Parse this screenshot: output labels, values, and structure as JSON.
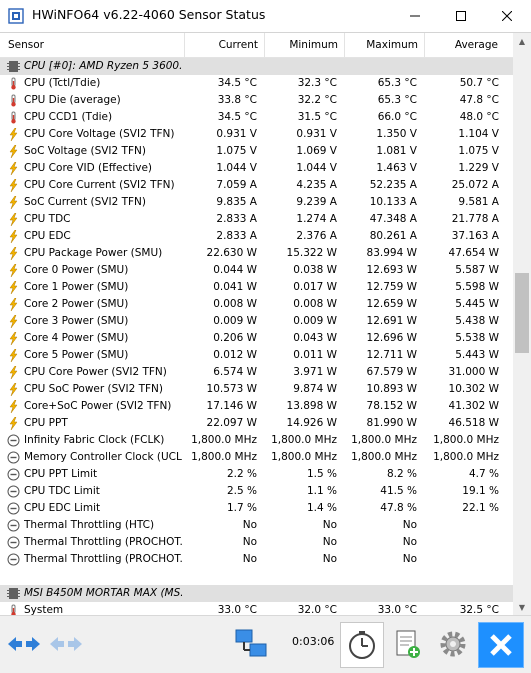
{
  "window": {
    "title": "HWiNFO64 v6.22-4060 Sensor Status"
  },
  "columns": {
    "sensor": "Sensor",
    "current": "Current",
    "minimum": "Minimum",
    "maximum": "Maximum",
    "average": "Average"
  },
  "rows": [
    {
      "type": "group",
      "name": "CPU [#0]: AMD Ryzen 5 3600...",
      "icon": "chip-icon"
    },
    {
      "type": "sensor",
      "icon": "thermometer-icon",
      "name": "CPU (Tctl/Tdie)",
      "current": "34.5 °C",
      "min": "32.3 °C",
      "max": "65.3 °C",
      "avg": "50.7 °C"
    },
    {
      "type": "sensor",
      "icon": "thermometer-icon",
      "name": "CPU Die (average)",
      "current": "33.8 °C",
      "min": "32.2 °C",
      "max": "65.3 °C",
      "avg": "47.8 °C"
    },
    {
      "type": "sensor",
      "icon": "thermometer-icon",
      "name": "CPU CCD1 (Tdie)",
      "current": "34.5 °C",
      "min": "31.5 °C",
      "max": "66.0 °C",
      "avg": "48.0 °C"
    },
    {
      "type": "sensor",
      "icon": "lightning-icon",
      "name": "CPU Core Voltage (SVI2 TFN)",
      "current": "0.931 V",
      "min": "0.931 V",
      "max": "1.350 V",
      "avg": "1.104 V"
    },
    {
      "type": "sensor",
      "icon": "lightning-icon",
      "name": "SoC Voltage (SVI2 TFN)",
      "current": "1.075 V",
      "min": "1.069 V",
      "max": "1.081 V",
      "avg": "1.075 V"
    },
    {
      "type": "sensor",
      "icon": "lightning-icon",
      "name": "CPU Core VID (Effective)",
      "current": "1.044 V",
      "min": "1.044 V",
      "max": "1.463 V",
      "avg": "1.229 V"
    },
    {
      "type": "sensor",
      "icon": "lightning-icon",
      "name": "CPU Core Current (SVI2 TFN)",
      "current": "7.059 A",
      "min": "4.235 A",
      "max": "52.235 A",
      "avg": "25.072 A"
    },
    {
      "type": "sensor",
      "icon": "lightning-icon",
      "name": "SoC Current (SVI2 TFN)",
      "current": "9.835 A",
      "min": "9.239 A",
      "max": "10.133 A",
      "avg": "9.581 A"
    },
    {
      "type": "sensor",
      "icon": "lightning-icon",
      "name": "CPU TDC",
      "current": "2.833 A",
      "min": "1.274 A",
      "max": "47.348 A",
      "avg": "21.778 A"
    },
    {
      "type": "sensor",
      "icon": "lightning-icon",
      "name": "CPU EDC",
      "current": "2.833 A",
      "min": "2.376 A",
      "max": "80.261 A",
      "avg": "37.163 A"
    },
    {
      "type": "sensor",
      "icon": "lightning-icon",
      "name": "CPU Package Power (SMU)",
      "current": "22.630 W",
      "min": "15.322 W",
      "max": "83.994 W",
      "avg": "47.654 W"
    },
    {
      "type": "sensor",
      "icon": "lightning-icon",
      "name": "Core 0 Power (SMU)",
      "current": "0.044 W",
      "min": "0.038 W",
      "max": "12.693 W",
      "avg": "5.587 W"
    },
    {
      "type": "sensor",
      "icon": "lightning-icon",
      "name": "Core 1 Power (SMU)",
      "current": "0.041 W",
      "min": "0.017 W",
      "max": "12.759 W",
      "avg": "5.598 W"
    },
    {
      "type": "sensor",
      "icon": "lightning-icon",
      "name": "Core 2 Power (SMU)",
      "current": "0.008 W",
      "min": "0.008 W",
      "max": "12.659 W",
      "avg": "5.445 W"
    },
    {
      "type": "sensor",
      "icon": "lightning-icon",
      "name": "Core 3 Power (SMU)",
      "current": "0.009 W",
      "min": "0.009 W",
      "max": "12.691 W",
      "avg": "5.438 W"
    },
    {
      "type": "sensor",
      "icon": "lightning-icon",
      "name": "Core 4 Power (SMU)",
      "current": "0.206 W",
      "min": "0.043 W",
      "max": "12.696 W",
      "avg": "5.538 W"
    },
    {
      "type": "sensor",
      "icon": "lightning-icon",
      "name": "Core 5 Power (SMU)",
      "current": "0.012 W",
      "min": "0.011 W",
      "max": "12.711 W",
      "avg": "5.443 W"
    },
    {
      "type": "sensor",
      "icon": "lightning-icon",
      "name": "CPU Core Power (SVI2 TFN)",
      "current": "6.574 W",
      "min": "3.971 W",
      "max": "67.579 W",
      "avg": "31.000 W"
    },
    {
      "type": "sensor",
      "icon": "lightning-icon",
      "name": "CPU SoC Power (SVI2 TFN)",
      "current": "10.573 W",
      "min": "9.874 W",
      "max": "10.893 W",
      "avg": "10.302 W"
    },
    {
      "type": "sensor",
      "icon": "lightning-icon",
      "name": "Core+SoC Power (SVI2 TFN)",
      "current": "17.146 W",
      "min": "13.898 W",
      "max": "78.152 W",
      "avg": "41.302 W"
    },
    {
      "type": "sensor",
      "icon": "lightning-icon",
      "name": "CPU PPT",
      "current": "22.097 W",
      "min": "14.926 W",
      "max": "81.990 W",
      "avg": "46.518 W"
    },
    {
      "type": "sensor",
      "icon": "clock-icon",
      "name": "Infinity Fabric Clock (FCLK)",
      "current": "1,800.0 MHz",
      "min": "1,800.0 MHz",
      "max": "1,800.0 MHz",
      "avg": "1,800.0 MHz"
    },
    {
      "type": "sensor",
      "icon": "clock-icon",
      "name": "Memory Controller Clock (UCLK)",
      "current": "1,800.0 MHz",
      "min": "1,800.0 MHz",
      "max": "1,800.0 MHz",
      "avg": "1,800.0 MHz"
    },
    {
      "type": "sensor",
      "icon": "clock-icon",
      "name": "CPU PPT Limit",
      "current": "2.2 %",
      "min": "1.5 %",
      "max": "8.2 %",
      "avg": "4.7 %"
    },
    {
      "type": "sensor",
      "icon": "clock-icon",
      "name": "CPU TDC Limit",
      "current": "2.5 %",
      "min": "1.1 %",
      "max": "41.5 %",
      "avg": "19.1 %"
    },
    {
      "type": "sensor",
      "icon": "clock-icon",
      "name": "CPU EDC Limit",
      "current": "1.7 %",
      "min": "1.4 %",
      "max": "47.8 %",
      "avg": "22.1 %"
    },
    {
      "type": "sensor",
      "icon": "clock-icon",
      "name": "Thermal Throttling (HTC)",
      "current": "No",
      "min": "No",
      "max": "No",
      "avg": ""
    },
    {
      "type": "sensor",
      "icon": "clock-icon",
      "name": "Thermal Throttling (PROCHOT...",
      "current": "No",
      "min": "No",
      "max": "No",
      "avg": ""
    },
    {
      "type": "sensor",
      "icon": "clock-icon",
      "name": "Thermal Throttling (PROCHOT...",
      "current": "No",
      "min": "No",
      "max": "No",
      "avg": ""
    },
    {
      "type": "blank"
    },
    {
      "type": "group",
      "name": "MSI B450M MORTAR MAX (MS...",
      "icon": "chip-icon"
    },
    {
      "type": "sensor",
      "icon": "thermometer-icon",
      "name": "System",
      "current": "33.0 °C",
      "min": "32.0 °C",
      "max": "33.0 °C",
      "avg": "32.5 °C"
    }
  ],
  "toolbar": {
    "timer": "0:03:06"
  }
}
